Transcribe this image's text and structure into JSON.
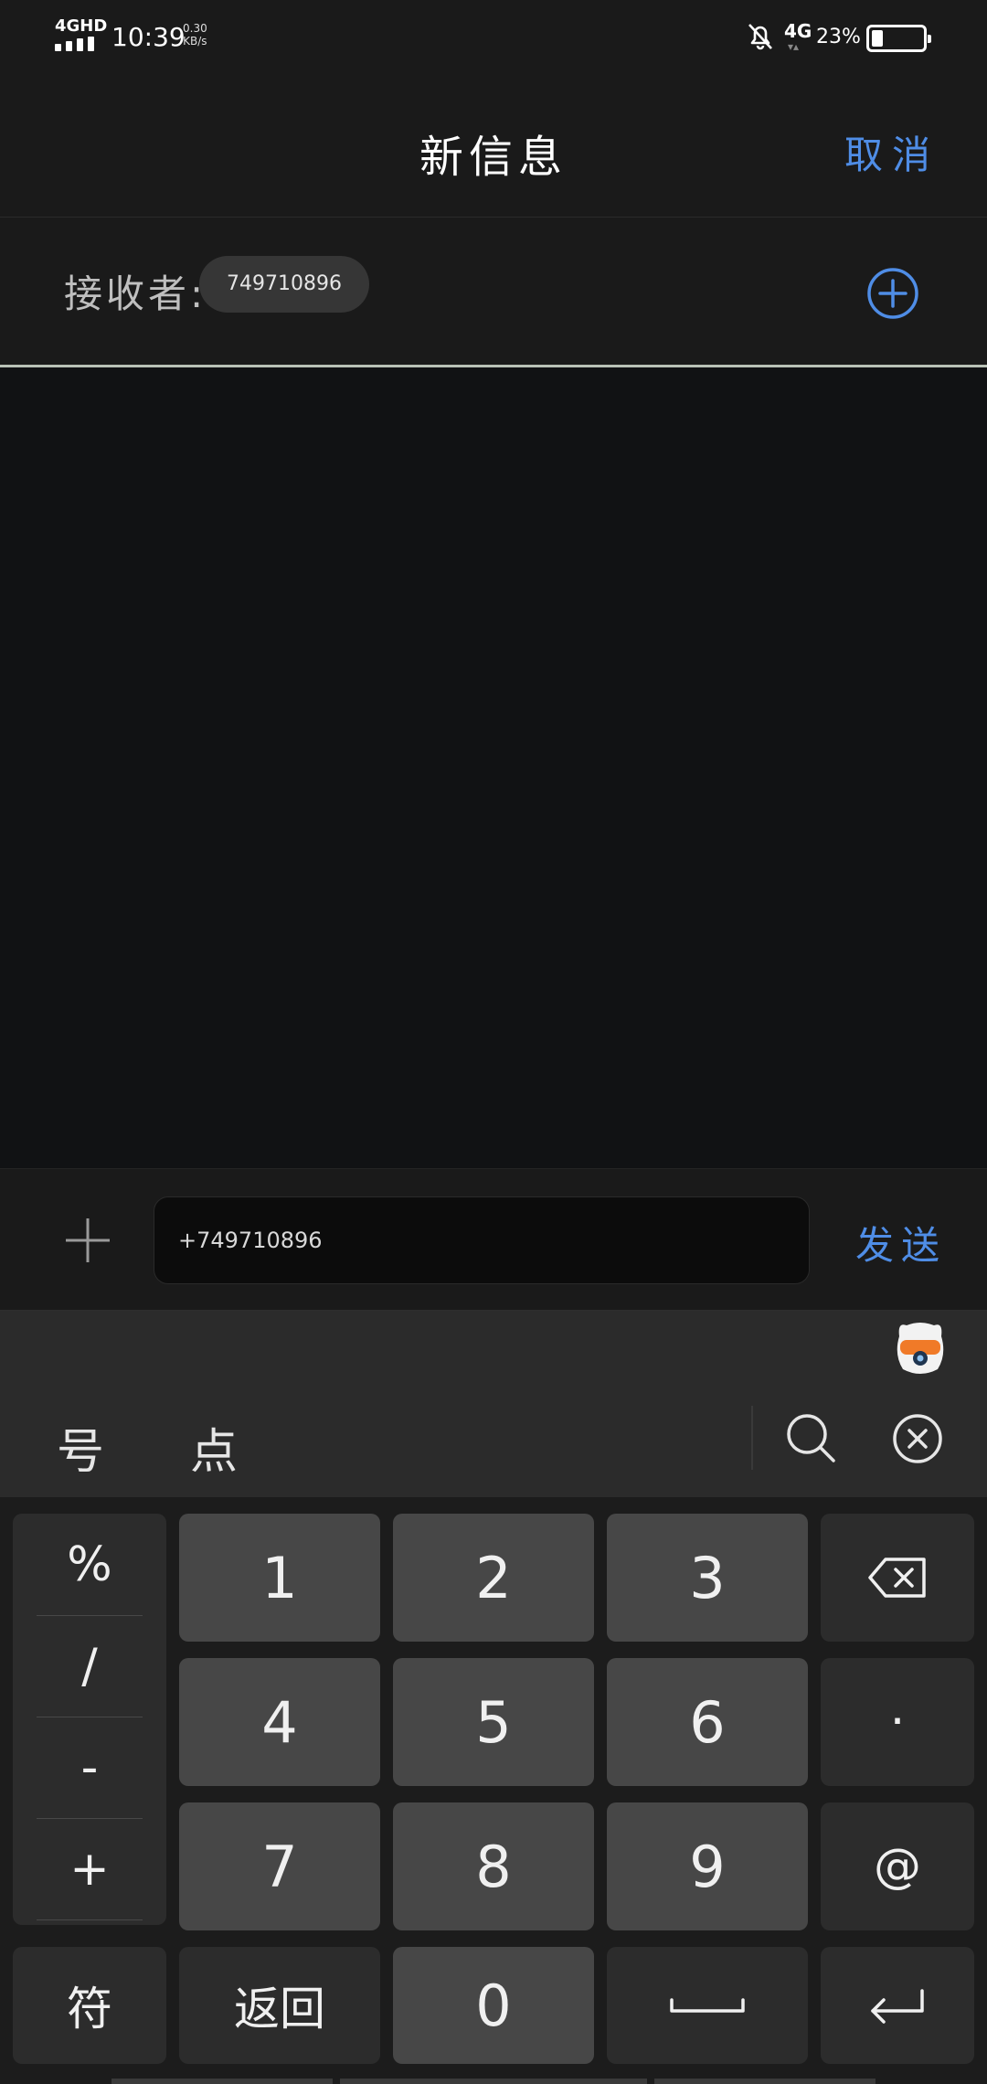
{
  "status_bar": {
    "network": "4GHD",
    "time": "10:39",
    "speed_value": "0.30",
    "speed_unit": "KB/s",
    "mobile": "4G",
    "battery_percent": "23%",
    "battery_level": 0.23
  },
  "header": {
    "title": "新信息",
    "cancel_label": "取消"
  },
  "recipient": {
    "label": "接收者:",
    "chip": "749710896"
  },
  "composer": {
    "input_value": "+749710896",
    "send_label": "发送"
  },
  "keyboard": {
    "candidates": [
      "号",
      "点"
    ],
    "symbols": [
      "%",
      "/",
      "-",
      "+"
    ],
    "digits": [
      "1",
      "2",
      "3",
      "4",
      "5",
      "6",
      "7",
      "8",
      "9",
      "0"
    ],
    "dot_key": "·",
    "at_key": "@",
    "fu_key": "符",
    "back_key": "返回"
  },
  "colors": {
    "accent": "#4f8de6",
    "background": "#111214",
    "key": "#474747"
  }
}
